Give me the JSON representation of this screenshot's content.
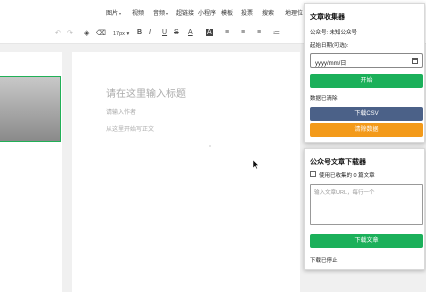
{
  "top_menu": {
    "items": [
      {
        "label": "图片",
        "caret": true
      },
      {
        "label": "视频",
        "caret": false
      },
      {
        "label": "音频",
        "caret": true
      },
      {
        "label": "超链接",
        "caret": false
      },
      {
        "label": "小程序",
        "caret": false
      },
      {
        "label": "模板",
        "caret": false
      },
      {
        "label": "投票",
        "caret": false
      },
      {
        "label": "搜索",
        "caret": false
      },
      {
        "label": "地理位",
        "caret": false
      }
    ]
  },
  "toolbar": {
    "font_size": "17px",
    "bold": "B",
    "italic": "I",
    "underline": "U",
    "strike": "S",
    "font_color": "A",
    "bg_color": "A",
    "align_left": "≡",
    "align_center": "≡",
    "align_right": "≡",
    "list": "≔"
  },
  "editor": {
    "title_placeholder": "请在这里输入标题",
    "author_placeholder": "请输入作者",
    "body_placeholder": "从这里开始写正文"
  },
  "collector": {
    "title": "文章收集器",
    "account_label": "公众号: 未知公众号",
    "start_date_label": "起始日期(可选):",
    "date_value": "yyyy/mm/日",
    "start_button": "开始",
    "status_text": "数据已清除",
    "download_csv_button": "下载CSV",
    "clear_button": "清除数据"
  },
  "downloader": {
    "title": "公众号文章下载器",
    "use_collected_label": "使用已收集的 0 篇文章",
    "url_placeholder": "输入文章URL，每行一个",
    "download_button": "下载文章",
    "status_text": "下载已停止"
  },
  "colors": {
    "green": "#1bb05a",
    "blue": "#4b6188",
    "orange": "#f39a1a"
  }
}
